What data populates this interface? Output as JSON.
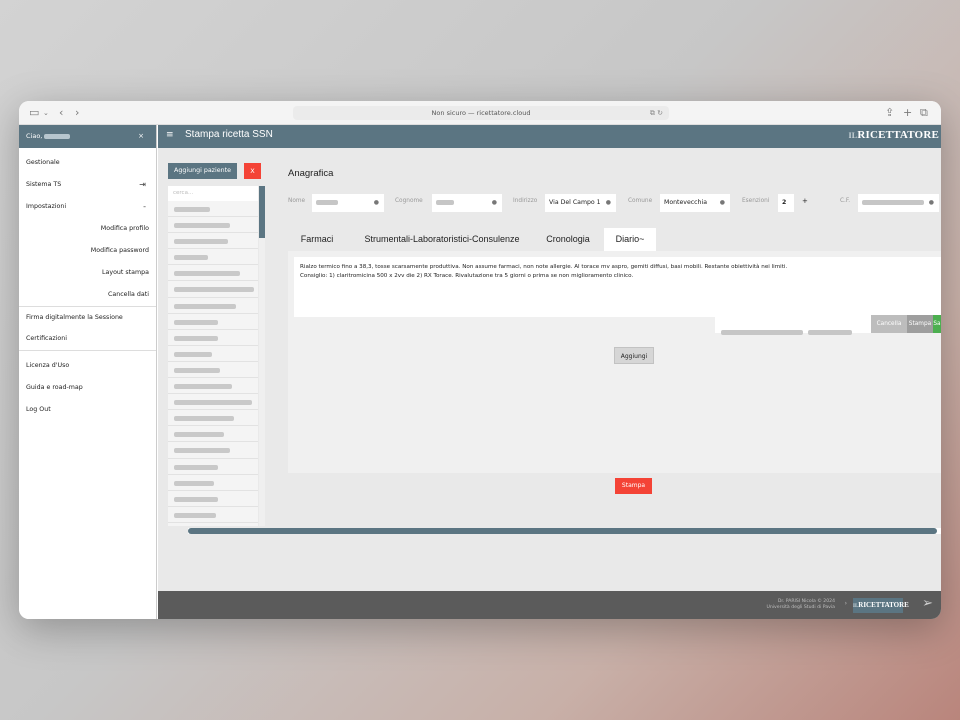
{
  "browser": {
    "url": "Non sicuro — ricettatore.cloud"
  },
  "sidebar": {
    "greeting": "Ciao,",
    "close": "×",
    "items": [
      {
        "label": "Gestionale"
      },
      {
        "label": "Sistema TS"
      },
      {
        "label": "Impostazioni"
      },
      {
        "label": "Modifica profilo"
      },
      {
        "label": "Modifica password"
      },
      {
        "label": "Layout stampa"
      },
      {
        "label": "Cancella dati"
      },
      {
        "label": "Firma digitalmente la Sessione"
      },
      {
        "label": "Certificazioni"
      },
      {
        "label": "Licenza d'Uso"
      },
      {
        "label": "Guida e road-map"
      },
      {
        "label": "Log Out"
      }
    ]
  },
  "topbar": {
    "title": "Stampa ricetta SSN",
    "logo_il": "IL",
    "logo": "RICETTATORE"
  },
  "patients": {
    "add_label": "Aggiungi paziente",
    "close_label": "X",
    "search_placeholder": "cerca..."
  },
  "anagrafica": {
    "heading": "Anagrafica",
    "nome_label": "Nome",
    "cognome_label": "Cognome",
    "indirizzo_label": "Indirizzo",
    "indirizzo_value": "Via Del Campo 1",
    "comune_label": "Comune",
    "comune_value": "Montevecchia",
    "esenzioni_label": "Esenzioni",
    "esenzioni_value": "2",
    "esenzioni_add": "+",
    "cf_label": "C.F."
  },
  "tabs": [
    {
      "label": "Farmaci"
    },
    {
      "label": "Strumentali-Laboratoristici-Consulenze"
    },
    {
      "label": "Cronologia"
    },
    {
      "label": "Diario~"
    }
  ],
  "diary": {
    "line1": "Rialzo termico fino a 38,3, tosse scarsamente produttiva. Non assume farmaci, non note allergie. Al torace mv aspro, gemiti diffusi, basi mobili. Restante obiettività nei limiti.",
    "line2": "Consiglio: 1) claritromicina 500 x 2vv die 2) RX Torace. Rivalutazione tra 5 giorni o prima se non miglioramento clinico.",
    "cancella": "Cancella",
    "stampa": "Stampa",
    "salva": "Sa",
    "aggiungi": "Aggiungi"
  },
  "print_button": "Stampa",
  "footer": {
    "credit_line1": "Dr. PARISI Nicola © 2024",
    "credit_line2": "Università degli Studi di Pavia",
    "logo_il": "IL",
    "logo": "RICETTATORE"
  },
  "colors": {
    "brand": "#5b7582",
    "danger": "#f44336",
    "success": "#4caf50"
  }
}
